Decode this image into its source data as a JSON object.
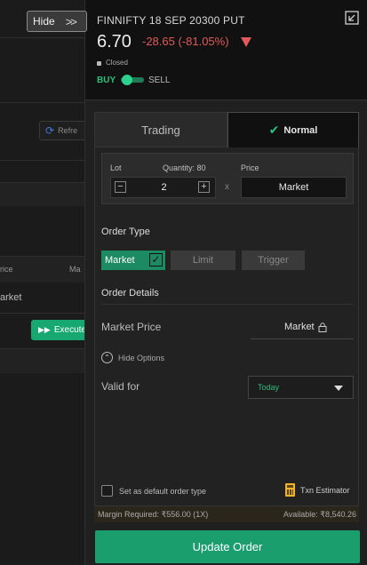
{
  "background": {
    "hide_button": {
      "label": "Hide",
      "icon": "double-chevron-right-icon"
    },
    "refresh_button": {
      "label": "Refre",
      "icon": "refresh-icon"
    },
    "table": {
      "col1_header": "rice",
      "col2_header": "Ma",
      "row1_cell": "arket"
    },
    "execute_button": {
      "label": "Execute",
      "icon": "play-icon"
    }
  },
  "instrument": {
    "symbol": "FINNIFTY 18 SEP 20300 PUT",
    "ltp": "6.70",
    "change": "-28.65 (-81.05%)",
    "trend_icon": "down-triangle-icon",
    "status": "Closed",
    "expand_icon": "expand-arrow-icon"
  },
  "side": {
    "buy_label": "BUY",
    "sell_label": "SELL",
    "selected": "BUY"
  },
  "tabs": {
    "trading": "Trading",
    "normal": "Normal",
    "active": "Normal"
  },
  "quantity": {
    "lot_label": "Lot",
    "quantity_label": "Quantity: 80",
    "value": "2",
    "minus": "−",
    "plus": "+",
    "multiplier": "x",
    "price_label": "Price",
    "price_value": "Market"
  },
  "order_type": {
    "label": "Order Type",
    "options": [
      "Market",
      "Limit",
      "Trigger"
    ],
    "selected": "Market"
  },
  "order_details": {
    "label": "Order Details",
    "market_price_label": "Market Price",
    "market_price_value": "Market",
    "hide_options_label": "Hide Options",
    "valid_for_label": "Valid for",
    "valid_for_value": "Today"
  },
  "footer": {
    "default_label": "Set as default order type",
    "txn_label": "Txn Estimator",
    "margin_required": "Margin Required:  ₹556.00 (1X)",
    "available": "Available:  ₹8,540.26",
    "update_button": "Update Order"
  },
  "colors": {
    "accent_green": "#1a9e6e",
    "loss_red": "#e05a5a",
    "panel_bg": "#202020"
  }
}
